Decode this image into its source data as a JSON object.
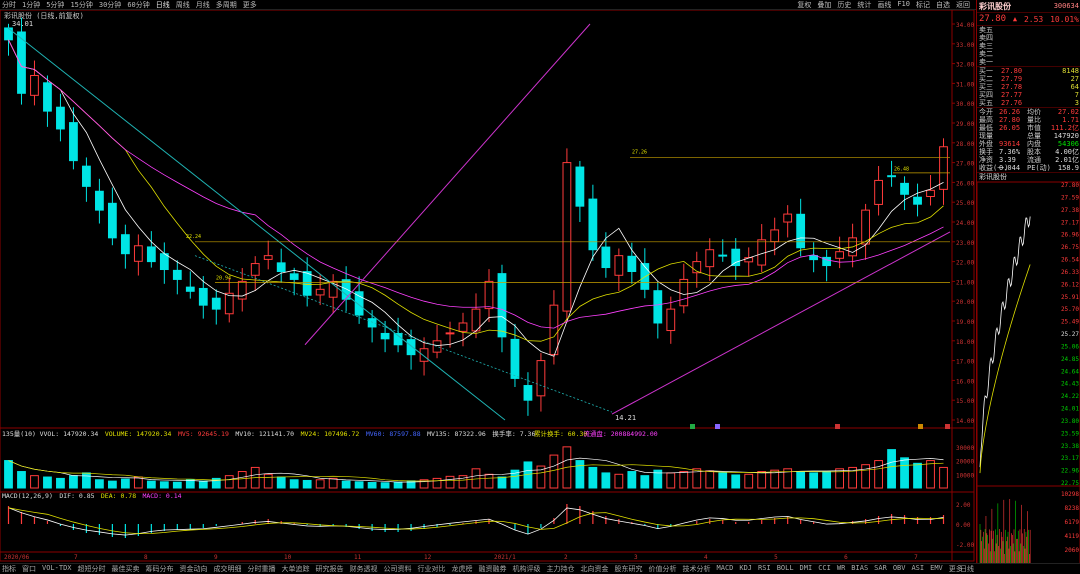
{
  "colors": {
    "up": "#ff3b3b",
    "down": "#00e5e5",
    "ma5": "#ffffff",
    "ma10": "#e0e000",
    "ma20": "#ff40ff",
    "grid": "#8b0000",
    "bg": "#000000"
  },
  "topbar": {
    "items": [
      "分时",
      "1分钟",
      "5分钟",
      "15分钟",
      "30分钟",
      "60分钟",
      "日线",
      "周线",
      "月线",
      "多周期",
      "更多"
    ],
    "active_index": 6,
    "right_tools": [
      "复权",
      "叠加",
      "历史",
      "统计",
      "画线",
      "F10",
      "标记",
      "自选",
      "返回"
    ]
  },
  "stock": {
    "name": "彩讯股份",
    "code": "300634",
    "price": "27.80",
    "change": "2.53",
    "pct": "10.01%"
  },
  "main_title": "彩讯股份 (日线,前复权)",
  "price_axis": [
    "34.00",
    "33.00",
    "32.00",
    "31.00",
    "30.00",
    "29.00",
    "28.00",
    "27.00",
    "26.00",
    "25.00",
    "24.00",
    "23.00",
    "22.00",
    "21.00",
    "20.00",
    "19.00",
    "18.00",
    "17.00",
    "16.00",
    "15.00",
    "14.00"
  ],
  "annotations": {
    "high": "34.01",
    "low": "14.21",
    "a1": "22.24",
    "a2": "20.94",
    "a3": "27.26",
    "a4": "26.48"
  },
  "volume_header": {
    "label1": "135量(10)",
    "vvol": "VVOL: 147920.34",
    "volume": "VOLUME: 147920.34",
    "mv5": "MV5: 92645.19",
    "mv10": "MV10: 121141.70",
    "mv24": "MV24: 107496.72",
    "mv60": "MV60: 87597.88",
    "mv135": "MV135: 87322.96",
    "turnover": "换手率: 7.36",
    "cum": "累计换手: 60.30",
    "float": "流通盘: 200884992.00"
  },
  "volume_axis": [
    "30000",
    "20000",
    "10000"
  ],
  "macd_header": {
    "title": "MACD(12,26,9)",
    "dif": "DIF: 0.85",
    "dea": "DEA: 0.78",
    "macd": "MACD: 0.14"
  },
  "macd_axis": [
    "2.00",
    "0.00",
    "-2.00"
  ],
  "date_axis": [
    "2020/06",
    "7",
    "8",
    "9",
    "10",
    "11",
    "12",
    "2021/1",
    "2",
    "3",
    "4",
    "5",
    "6",
    "7"
  ],
  "bottombar": [
    "指标",
    "窗口",
    "VOL-TDX",
    "超短分时",
    "最佳买卖",
    "筹码分布",
    "资金动向",
    "成交明细",
    "分时重播",
    "大单追踪",
    "研究报告",
    "财务透视",
    "公司资料",
    "行业对比",
    "龙虎榜",
    "融资融券",
    "机构评级",
    "主力持仓",
    "北向资金",
    "股东研究",
    "价值分析",
    "技术分析",
    "MACD",
    "KDJ",
    "RSI",
    "BOLL",
    "DMI",
    "CCI",
    "WR",
    "BIAS",
    "SAR",
    "OBV",
    "ASI",
    "EMV",
    "更多",
    "设置"
  ],
  "orderbook": {
    "sells": [
      [
        "卖五",
        "",
        ""
      ],
      [
        "卖四",
        "",
        ""
      ],
      [
        "卖三",
        "",
        ""
      ],
      [
        "卖二",
        "",
        ""
      ],
      [
        "卖一",
        "",
        ""
      ]
    ],
    "buys": [
      [
        "买一",
        "27.80",
        "8148"
      ],
      [
        "买二",
        "27.79",
        "27"
      ],
      [
        "买三",
        "27.78",
        "64"
      ],
      [
        "买四",
        "27.77",
        "7"
      ],
      [
        "买五",
        "27.76",
        "3"
      ]
    ]
  },
  "stats": [
    [
      "今开",
      "26.26",
      "均价",
      "27.02"
    ],
    [
      "最高",
      "27.80",
      "量比",
      "1.71"
    ],
    [
      "最低",
      "26.05",
      "市值",
      "111.2亿"
    ],
    [
      "现量",
      "",
      "总量",
      "147920"
    ],
    [
      "外盘",
      "93614",
      "内盘",
      "54306"
    ],
    [
      "换手",
      "7.36%",
      "股本",
      "4.00亿"
    ],
    [
      "净资",
      "3.39",
      "流通",
      "2.01亿"
    ],
    [
      "收益(一)",
      "0.044",
      "PE(动)",
      "158.9"
    ]
  ],
  "mini_title": "彩讯股份",
  "mini_axis_right": [
    "27.80",
    "27.59",
    "27.38",
    "27.17",
    "26.96",
    "26.75",
    "26.54",
    "26.33",
    "26.12",
    "25.91",
    "25.70",
    "25.49",
    "25.27",
    "25.06",
    "24.85",
    "24.64",
    "24.43",
    "24.22",
    "24.01",
    "23.80",
    "23.59",
    "23.38",
    "23.17",
    "22.96",
    "22.75"
  ],
  "mini_pct": [
    "10.01%",
    "9.19%",
    "8.36%",
    "7.53%",
    "6.70%",
    "5.87%",
    "5.04%",
    "4.21%",
    "3.38%",
    "2.55%",
    "1.72%",
    "0.88%",
    "0.05%",
    "-0.78%",
    "-1.61%",
    "-2.44%",
    "-3.27%",
    "-4.10%",
    "-4.93%",
    "-5.76%",
    "-6.59%",
    "-7.42%",
    "-8.25%",
    "-9.08%",
    "-9.91%"
  ],
  "mini_vol_axis": [
    "10298",
    "8238",
    "6179",
    "4119",
    "2060"
  ],
  "mini_tab": "日线",
  "chart_data": [
    {
      "type": "candlestick",
      "title": "彩讯股份 (日线,前复权)",
      "x": [
        "2020/06",
        "7",
        "8",
        "9",
        "10",
        "11",
        "12",
        "2021/1",
        "2",
        "3",
        "4",
        "5",
        "6",
        "7"
      ],
      "ylim": [
        14,
        34
      ],
      "high": 34.01,
      "low": 14.21,
      "last_close": 27.8,
      "closes": [
        33.2,
        30.5,
        31.4,
        29.6,
        28.7,
        27.1,
        25.8,
        24.6,
        23.2,
        22.4,
        22.8,
        22.0,
        21.6,
        21.1,
        20.5,
        19.8,
        19.6,
        20.4,
        21.0,
        21.9,
        22.3,
        21.5,
        21.1,
        20.3,
        20.6,
        21.0,
        20.1,
        19.3,
        18.7,
        18.1,
        17.8,
        17.3,
        17.6,
        18.0,
        18.4,
        18.9,
        19.6,
        21.0,
        18.2,
        16.1,
        15.0,
        17.0,
        19.8,
        27.0,
        24.8,
        22.6,
        21.7,
        22.3,
        21.5,
        20.6,
        18.9,
        19.6,
        21.1,
        22.0,
        22.6,
        22.3,
        21.8,
        22.2,
        23.1,
        23.6,
        24.4,
        22.7,
        22.1,
        21.8,
        22.5,
        23.2,
        24.6,
        26.1,
        26.3,
        25.4,
        24.9,
        25.6,
        27.8
      ],
      "series": [
        {
          "name": "MA5"
        },
        {
          "name": "MA10"
        },
        {
          "name": "MA20"
        }
      ]
    },
    {
      "type": "bar",
      "title": "135量(10)",
      "ylim": [
        0,
        35000
      ],
      "values": [
        20000,
        12000,
        9000,
        8000,
        7000,
        9000,
        11000,
        6000,
        5000,
        6500,
        8000,
        5000,
        4500,
        4200,
        6000,
        5000,
        7000,
        9000,
        12000,
        15000,
        10000,
        8000,
        6000,
        5500,
        6000,
        7000,
        5000,
        4500,
        4000,
        3800,
        4200,
        5200,
        6000,
        7000,
        8500,
        9000,
        14000,
        10000,
        8000,
        13000,
        19000,
        16000,
        24000,
        30000,
        20000,
        15000,
        11000,
        10000,
        12000,
        9000,
        13000,
        11000,
        12000,
        14000,
        12500,
        11000,
        9500,
        10000,
        12000,
        13000,
        14000,
        12000,
        11000,
        12000,
        14000,
        15000,
        17000,
        20000,
        28000,
        22000,
        18000,
        20000,
        15000
      ],
      "series": [
        {
          "name": "MV5"
        },
        {
          "name": "MV10"
        }
      ]
    },
    {
      "type": "bar",
      "title": "MACD(12,26,9)",
      "ylim": [
        -2.6,
        2.6
      ],
      "values": [
        1.8,
        1.2,
        0.7,
        0.3,
        -0.2,
        -0.6,
        -0.9,
        -1.1,
        -1.3,
        -1.4,
        -1.2,
        -0.9,
        -0.7,
        -0.6,
        -0.5,
        -0.4,
        -0.2,
        0.0,
        0.2,
        0.4,
        0.5,
        0.3,
        0.1,
        -0.1,
        -0.2,
        -0.2,
        -0.3,
        -0.5,
        -0.7,
        -0.8,
        -0.8,
        -0.7,
        -0.5,
        -0.3,
        -0.1,
        0.1,
        0.3,
        0.5,
        0.0,
        -0.6,
        -1.0,
        -0.4,
        0.6,
        2.0,
        1.8,
        1.3,
        0.8,
        0.5,
        0.2,
        -0.1,
        -0.5,
        -0.3,
        0.0,
        0.3,
        0.5,
        0.4,
        0.2,
        0.2,
        0.4,
        0.6,
        0.7,
        0.4,
        0.2,
        0.0,
        0.1,
        0.3,
        0.5,
        0.8,
        1.0,
        0.9,
        0.7,
        0.7,
        0.9
      ],
      "series": [
        {
          "name": "DIF"
        },
        {
          "name": "DEA"
        }
      ]
    }
  ]
}
